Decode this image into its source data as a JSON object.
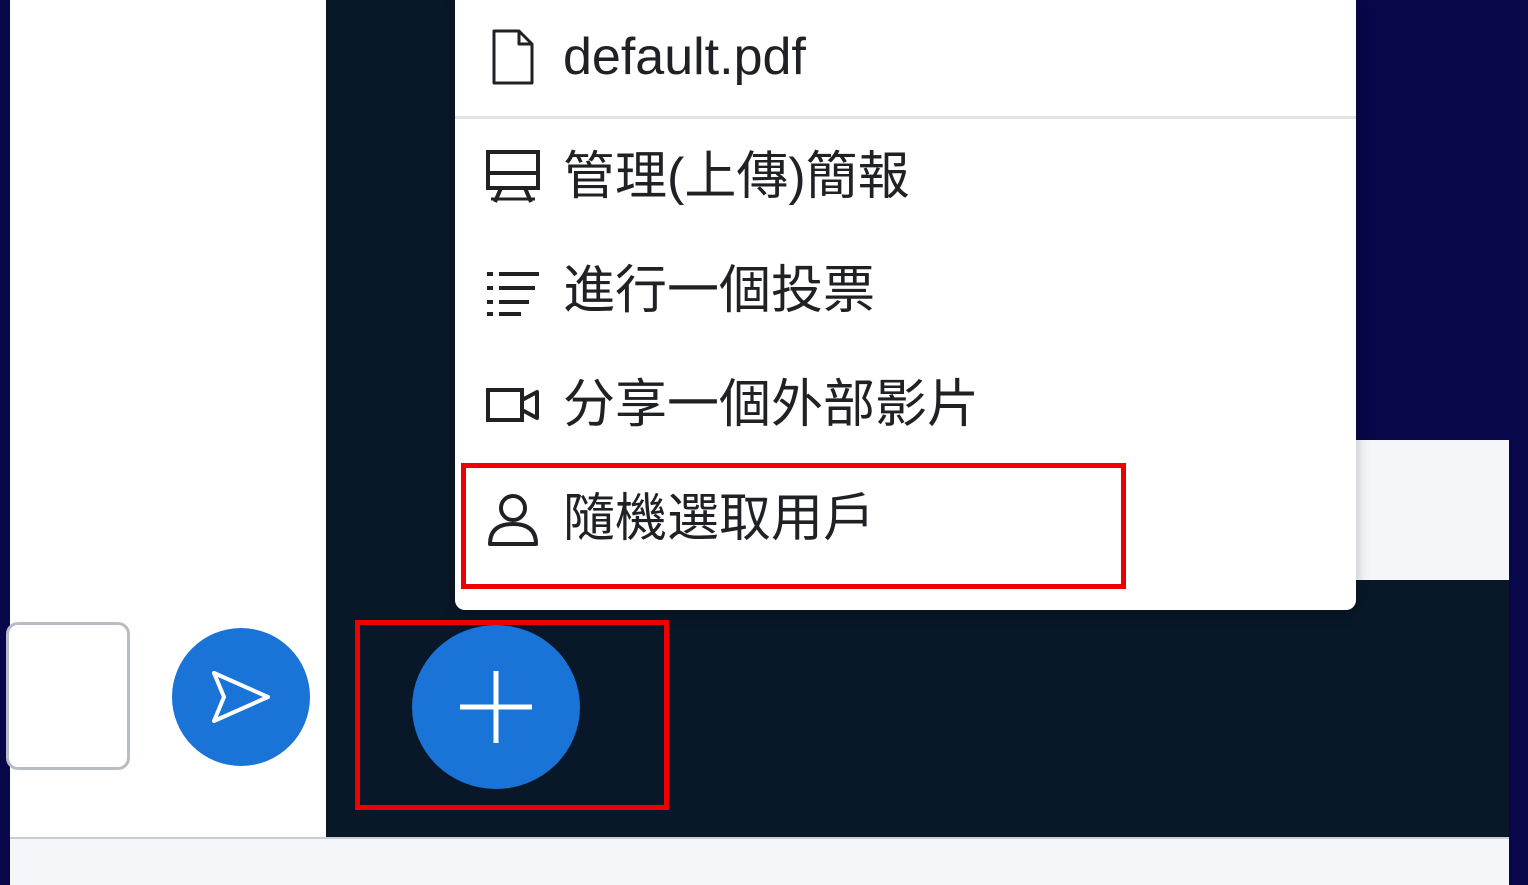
{
  "chat": {
    "send_icon": "send-arrow-icon"
  },
  "actions_button": {
    "icon": "plus-icon"
  },
  "menu": {
    "items": [
      {
        "label": "default.pdf",
        "icon": "file-icon"
      },
      {
        "label": "管理(上傳)簡報",
        "icon": "presentation-icon"
      },
      {
        "label": "進行一個投票",
        "icon": "poll-list-icon"
      },
      {
        "label": "分享一個外部影片",
        "icon": "video-camera-icon"
      },
      {
        "label": "隨機選取用戶",
        "icon": "user-icon"
      }
    ]
  },
  "colors": {
    "accent": "#1a73d6",
    "highlight": "#ee0000",
    "stage_bg": "#081828",
    "outer_bg": "#07074a"
  }
}
